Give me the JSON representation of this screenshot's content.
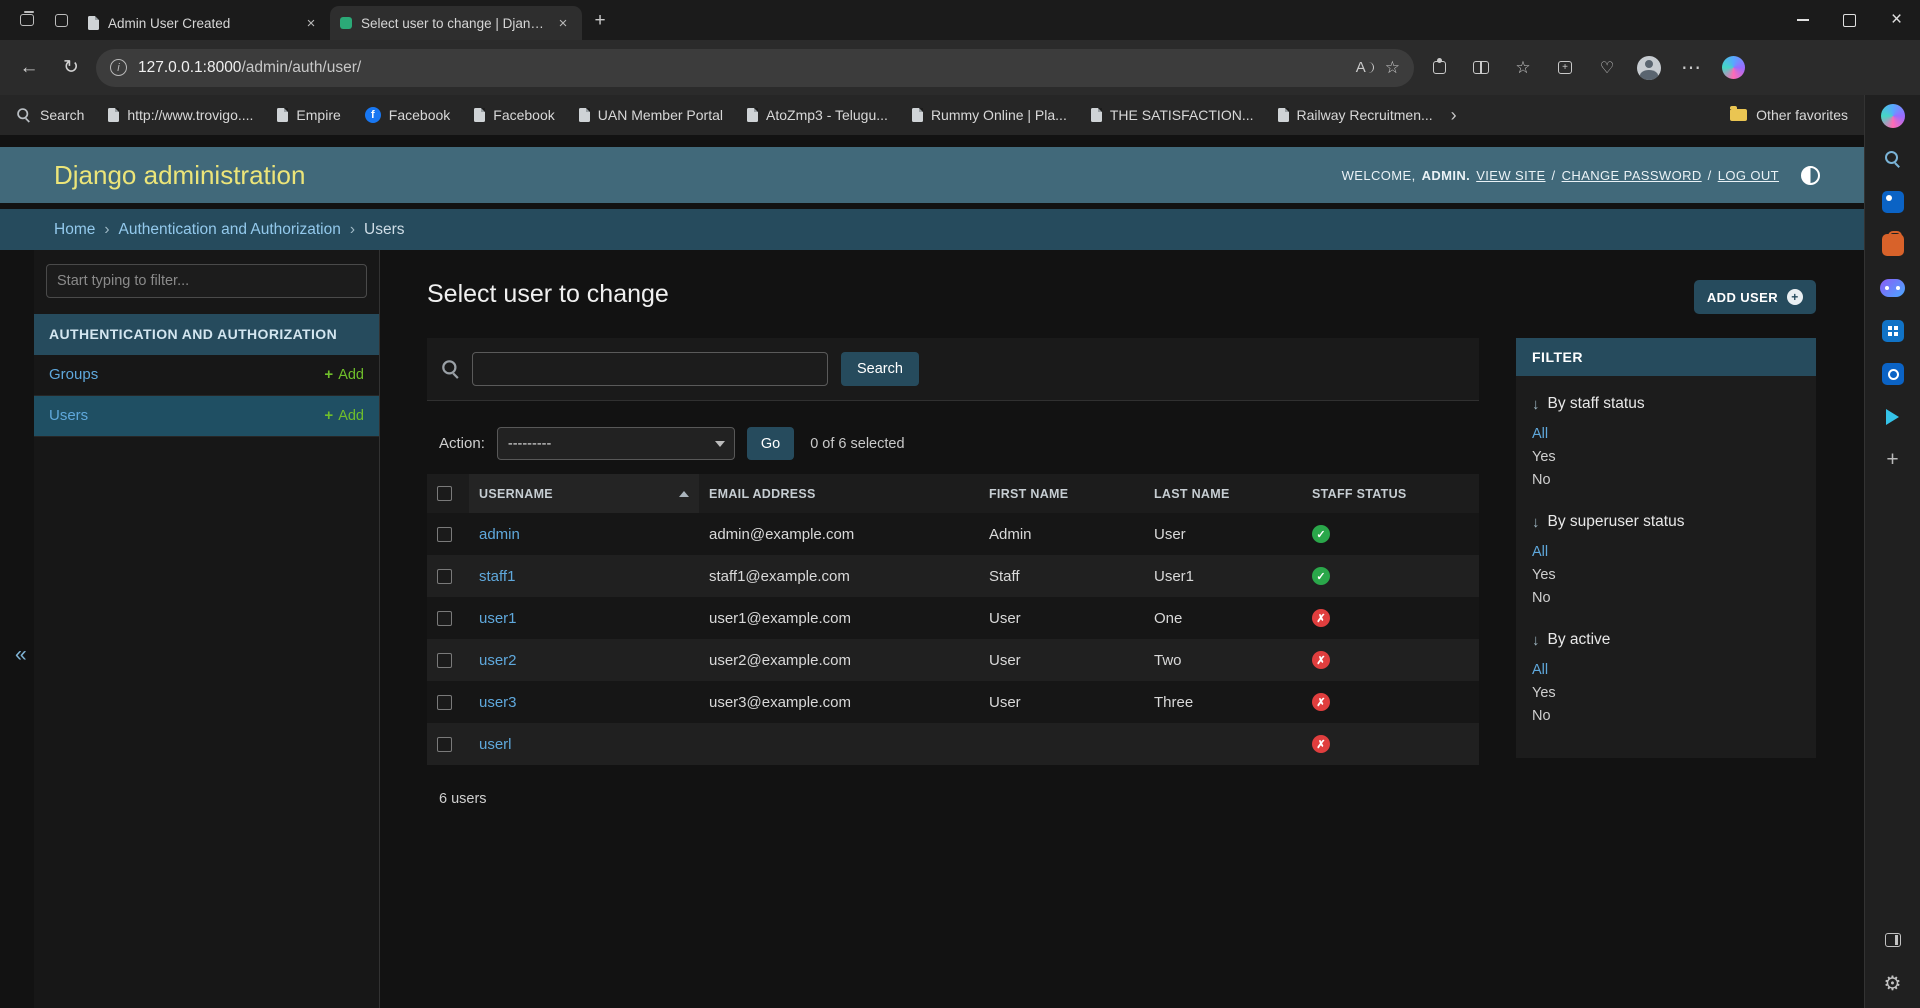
{
  "colors": {
    "accent": "#264b5d",
    "header-bg": "#41697a",
    "header-title": "#ece579",
    "link": "#5fa8dc",
    "add-green": "#70bf2b",
    "success": "#2aa74a",
    "error": "#e03e3e"
  },
  "browser": {
    "tabs": [
      {
        "title": "Admin User Created",
        "active": false
      },
      {
        "title": "Select user to change | Django si",
        "active": true
      }
    ],
    "new_tab_glyph": "+",
    "url": {
      "host": "127.0.0.1:8000",
      "path": "/admin/auth/user/"
    },
    "favorites": [
      {
        "label": "Search"
      },
      {
        "label": "http://www.trovigo...."
      },
      {
        "label": "Empire"
      },
      {
        "label": "Facebook"
      },
      {
        "label": "Facebook"
      },
      {
        "label": "UAN Member Portal"
      },
      {
        "label": "AtoZmp3 - Telugu..."
      },
      {
        "label": "Rummy Online | Pla..."
      },
      {
        "label": "THE SATISFACTION..."
      },
      {
        "label": "Railway Recruitmen..."
      }
    ],
    "other_favorites": "Other favorites"
  },
  "header": {
    "site_title": "Django administration",
    "welcome": "WELCOME,",
    "username": "ADMIN.",
    "view_site": "VIEW SITE",
    "sep": "/",
    "change_password": "CHANGE PASSWORD",
    "log_out": "LOG OUT"
  },
  "breadcrumbs": {
    "home": "Home",
    "sep": "›",
    "app": "Authentication and Authorization",
    "current": "Users"
  },
  "sidebar": {
    "filter_placeholder": "Start typing to filter...",
    "section_title": "AUTHENTICATION AND AUTHORIZATION",
    "items": [
      {
        "label": "Groups",
        "add_label": "Add",
        "current": false
      },
      {
        "label": "Users",
        "add_label": "Add",
        "current": true
      }
    ],
    "collapse_glyph": "«"
  },
  "main": {
    "page_title": "Select user to change",
    "add_user_button": "ADD USER",
    "search_button": "Search",
    "action_label": "Action:",
    "action_value": "---------",
    "go_button": "Go",
    "selection_note": "0 of 6 selected",
    "result_count": "6 users"
  },
  "table": {
    "headers": {
      "username": "USERNAME",
      "email": "EMAIL ADDRESS",
      "first_name": "FIRST NAME",
      "last_name": "LAST NAME",
      "staff_status": "STAFF STATUS"
    },
    "rows": [
      {
        "username": "admin",
        "email": "admin@example.com",
        "first_name": "Admin",
        "last_name": "User",
        "staff": true
      },
      {
        "username": "staff1",
        "email": "staff1@example.com",
        "first_name": "Staff",
        "last_name": "User1",
        "staff": true
      },
      {
        "username": "user1",
        "email": "user1@example.com",
        "first_name": "User",
        "last_name": "One",
        "staff": false
      },
      {
        "username": "user2",
        "email": "user2@example.com",
        "first_name": "User",
        "last_name": "Two",
        "staff": false
      },
      {
        "username": "user3",
        "email": "user3@example.com",
        "first_name": "User",
        "last_name": "Three",
        "staff": false
      },
      {
        "username": "userl",
        "email": "",
        "first_name": "",
        "last_name": "",
        "staff": false
      }
    ]
  },
  "filter": {
    "title": "FILTER",
    "sections": [
      {
        "heading": "By staff status",
        "options": [
          {
            "label": "All",
            "selected": true
          },
          {
            "label": "Yes",
            "selected": false
          },
          {
            "label": "No",
            "selected": false
          }
        ]
      },
      {
        "heading": "By superuser status",
        "options": [
          {
            "label": "All",
            "selected": true
          },
          {
            "label": "Yes",
            "selected": false
          },
          {
            "label": "No",
            "selected": false
          }
        ]
      },
      {
        "heading": "By active",
        "options": [
          {
            "label": "All",
            "selected": true
          },
          {
            "label": "Yes",
            "selected": false
          },
          {
            "label": "No",
            "selected": false
          }
        ]
      }
    ]
  }
}
